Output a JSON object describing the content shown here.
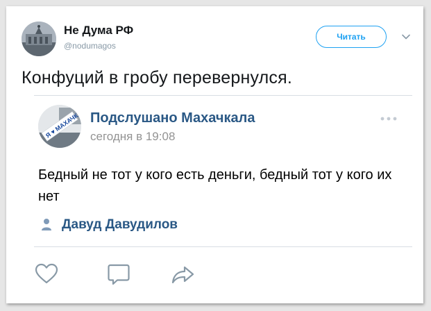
{
  "tweet": {
    "display_name": "Не Дума РФ",
    "handle": "@nodumagos",
    "follow_label": "Читать",
    "text": "Конфуций в гробу перевернулся."
  },
  "embedded_post": {
    "community_name": "Подслушано Махачкала",
    "timestamp": "сегодня в 19:08",
    "text": "Бедный не тот у кого есть деньги, бедный тот у кого их нет",
    "author": "Давуд Давудилов",
    "avatar_text": "Я ♥ МАХАЧКАЛА"
  },
  "colors": {
    "twitter_blue": "#1da1f2",
    "vk_link": "#2a5885",
    "icon_gray": "#8899a6"
  },
  "icons": [
    "chevron-down-icon",
    "more-icon",
    "person-icon",
    "heart-icon",
    "reply-icon",
    "retweet-icon"
  ]
}
